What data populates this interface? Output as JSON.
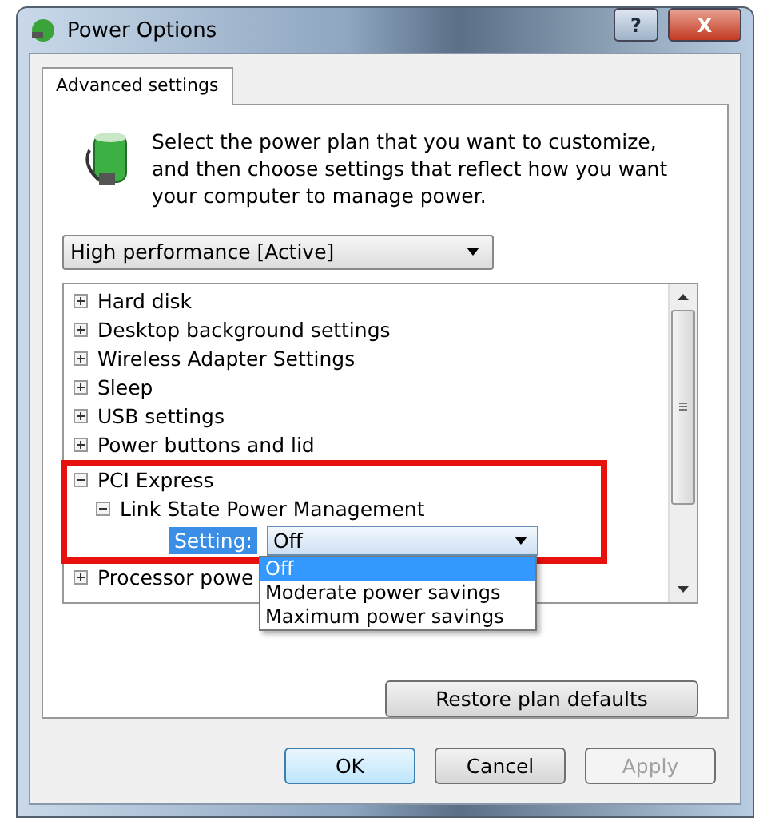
{
  "window": {
    "title": "Power Options",
    "help_glyph": "?",
    "close_glyph": "X"
  },
  "tabs": [
    {
      "label": "Advanced settings",
      "selected": true
    }
  ],
  "intro": "Select the power plan that you want to customize, and then choose settings that reflect how you want your computer to manage power.",
  "plan_dropdown": {
    "value": "High performance [Active]"
  },
  "tree": [
    {
      "label": "Hard disk",
      "expanded": false,
      "highlighted": false
    },
    {
      "label": "Desktop background settings",
      "expanded": false,
      "highlighted": false
    },
    {
      "label": "Wireless Adapter Settings",
      "expanded": false,
      "highlighted": false
    },
    {
      "label": "Sleep",
      "expanded": false,
      "highlighted": false
    },
    {
      "label": "USB settings",
      "expanded": false,
      "highlighted": false
    },
    {
      "label": "Power buttons and lid",
      "expanded": false,
      "highlighted": false
    },
    {
      "label": "PCI Express",
      "expanded": true,
      "highlighted": true,
      "children": [
        {
          "label": "Link State Power Management",
          "expanded": true,
          "setting": {
            "label": "Setting:",
            "value": "Off",
            "options": [
              {
                "label": "Off",
                "selected": true
              },
              {
                "label": "Moderate power savings",
                "selected": false
              },
              {
                "label": "Maximum power savings",
                "selected": false
              }
            ]
          }
        }
      ]
    },
    {
      "label": "Processor powe",
      "expanded": false,
      "highlighted": false
    }
  ],
  "restore_button": "Restore plan defaults",
  "buttons": [
    {
      "label": "OK",
      "disabled": false,
      "default": true
    },
    {
      "label": "Cancel",
      "disabled": false,
      "default": false
    },
    {
      "label": "Apply",
      "disabled": true,
      "default": false
    }
  ]
}
